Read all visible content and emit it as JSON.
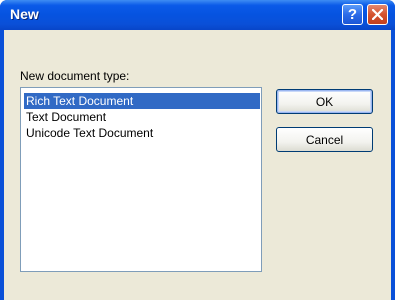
{
  "window": {
    "title": "New",
    "help_label": "?",
    "close_icon": "close-icon"
  },
  "dialog": {
    "label": "New document type:",
    "document_types": [
      {
        "label": "Rich Text Document",
        "selected": true
      },
      {
        "label": "Text Document",
        "selected": false
      },
      {
        "label": "Unicode Text Document",
        "selected": false
      }
    ],
    "ok_label": "OK",
    "cancel_label": "Cancel"
  },
  "colors": {
    "titlebar_blue": "#0a50d8",
    "dialog_face": "#ece9d8",
    "selection": "#316ac5",
    "close_red": "#d5522e"
  }
}
